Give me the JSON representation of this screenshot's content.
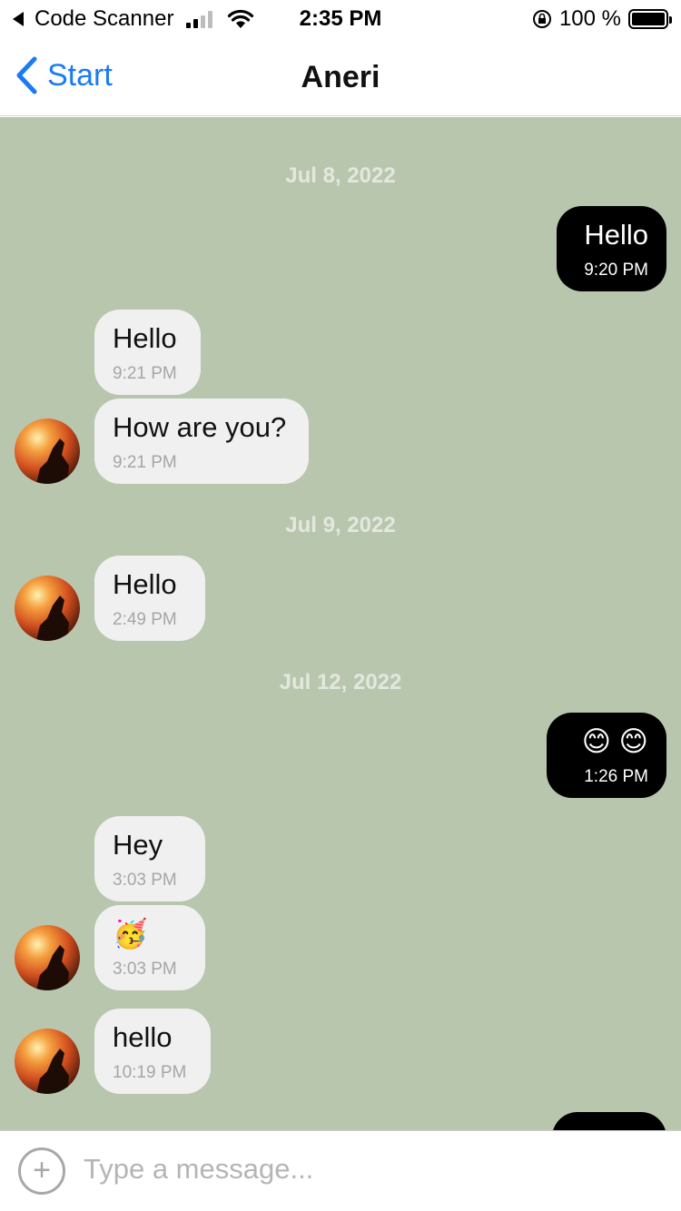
{
  "status_bar": {
    "back_app": "Code Scanner",
    "time": "2:35 PM",
    "battery": "100 %"
  },
  "nav": {
    "back_label": "Start",
    "title": "Aneri"
  },
  "dates": [
    "Jul 8, 2022",
    "Jul 9, 2022",
    "Jul 12, 2022"
  ],
  "messages": [
    {
      "text": "Hello",
      "time": "9:20 PM"
    },
    {
      "text": "Hello",
      "time": "9:21 PM"
    },
    {
      "text": "How are you?",
      "time": "9:21 PM"
    },
    {
      "text": "Hello",
      "time": "2:49 PM"
    },
    {
      "text": "😊 😊",
      "time": "1:26 PM"
    },
    {
      "text": "Hey",
      "time": "3:03 PM"
    },
    {
      "text": "🥳",
      "time": "3:03 PM"
    },
    {
      "text": "hello",
      "time": "10:19 PM"
    }
  ],
  "input": {
    "placeholder": "Type a message..."
  },
  "colors": {
    "chat_background": "#b9c6ae",
    "incoming_bubble": "#f0f0f0",
    "outgoing_bubble": "#000000",
    "accent": "#1a7cf2"
  }
}
